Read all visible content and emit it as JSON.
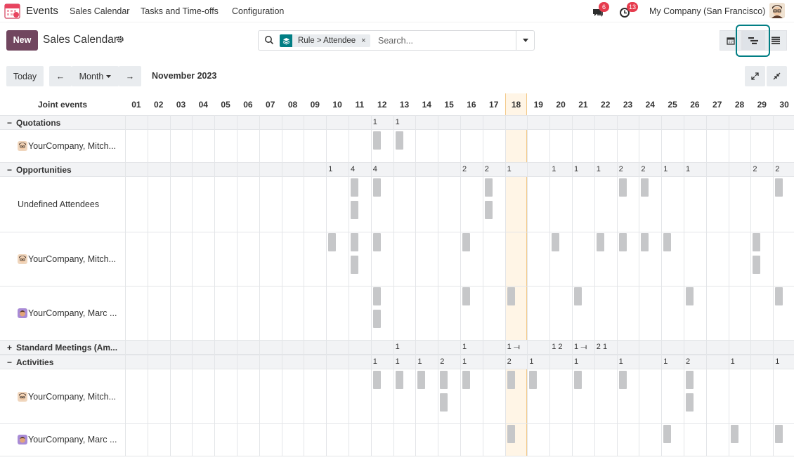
{
  "navbar": {
    "app_name": "Events",
    "menus": [
      "Sales Calendar",
      "Tasks and Time-offs",
      "Configuration"
    ],
    "messages_count": "6",
    "activities_count": "13",
    "company": "My Company (San Francisco)"
  },
  "control": {
    "new_label": "New",
    "title": "Sales Calendar",
    "facet_label": "Rule > Attendee",
    "facet_remove": "×",
    "search_placeholder": "Search..."
  },
  "toolbar": {
    "today_label": "Today",
    "prev_label": "←",
    "scale_label": "Month",
    "next_label": "→",
    "period": "November 2023"
  },
  "gantt": {
    "corner_label": "Joint events",
    "days": [
      "01",
      "02",
      "03",
      "04",
      "05",
      "06",
      "07",
      "08",
      "09",
      "10",
      "11",
      "12",
      "13",
      "14",
      "15",
      "16",
      "17",
      "18",
      "19",
      "20",
      "21",
      "22",
      "23",
      "24",
      "25",
      "26",
      "27",
      "28",
      "29",
      "30"
    ],
    "today_index": 17,
    "groups": [
      {
        "label": "Quotations",
        "toggle": "−",
        "counts": {
          "12": "1",
          "13": "1"
        },
        "rows": [
          {
            "label": "YourCompany, Mitch...",
            "avatar": "mitchell",
            "bars": [
              [
                12,
                1,
                0
              ],
              [
                13,
                1,
                0
              ]
            ]
          }
        ]
      },
      {
        "label": "Opportunities",
        "toggle": "−",
        "counts": {
          "10": "1",
          "11": "4",
          "12": "4",
          "16": "2",
          "17": "2",
          "18": "1",
          "20": "1",
          "21": "1",
          "22": "1",
          "23": "2",
          "24": "2",
          "25": "1",
          "26": "1",
          "29": "2",
          "30": "2"
        },
        "rows": [
          {
            "label": "Undefined Attendees",
            "avatar": "",
            "bars": [
              [
                11,
                1,
                0
              ],
              [
                11,
                1,
                1
              ],
              [
                12,
                1,
                0
              ],
              [
                17,
                1,
                0
              ],
              [
                17,
                1,
                1
              ],
              [
                23,
                1,
                0
              ],
              [
                24,
                1,
                0
              ],
              [
                30,
                1,
                0
              ]
            ]
          },
          {
            "label": "YourCompany, Mitch...",
            "avatar": "mitchell",
            "bars": [
              [
                10,
                1,
                0
              ],
              [
                11,
                1,
                0
              ],
              [
                11,
                1,
                1
              ],
              [
                12,
                1,
                0
              ],
              [
                16,
                1,
                0
              ],
              [
                20,
                1,
                0
              ],
              [
                22,
                1,
                0
              ],
              [
                23,
                1,
                0
              ],
              [
                24,
                1,
                0
              ],
              [
                25,
                1,
                0
              ],
              [
                29,
                1,
                0
              ],
              [
                29,
                1,
                1
              ]
            ]
          },
          {
            "label": "YourCompany, Marc ...",
            "avatar": "marc",
            "bars": [
              [
                12,
                1,
                0
              ],
              [
                12,
                1,
                1
              ],
              [
                16,
                1,
                0
              ],
              [
                18,
                1,
                0
              ],
              [
                21,
                1,
                0
              ],
              [
                26,
                1,
                0
              ],
              [
                30,
                1,
                0
              ]
            ]
          }
        ]
      },
      {
        "label": "Standard Meetings (Am...",
        "toggle": "+",
        "counts": {
          "13": "1",
          "16": "1",
          "18": "1 ⟞",
          "20": "1 2",
          "21": "1 ⟞",
          "22": "2 1"
        },
        "rows": []
      },
      {
        "label": "Activities",
        "toggle": "−",
        "counts": {
          "12": "1",
          "13": "1",
          "14": "1",
          "15": "2",
          "16": "1",
          "18": "2",
          "19": "1",
          "21": "1",
          "23": "1",
          "25": "1",
          "26": "2",
          "28": "1",
          "30": "1"
        },
        "rows": [
          {
            "label": "YourCompany, Mitch...",
            "avatar": "mitchell",
            "bars": [
              [
                12,
                1,
                0
              ],
              [
                13,
                1,
                0
              ],
              [
                14,
                1,
                0
              ],
              [
                15,
                1,
                0
              ],
              [
                15,
                1,
                1
              ],
              [
                16,
                1,
                0
              ],
              [
                18,
                1,
                0
              ],
              [
                19,
                1,
                0
              ],
              [
                21,
                1,
                0
              ],
              [
                23,
                1,
                0
              ],
              [
                26,
                1,
                0
              ],
              [
                26,
                1,
                1
              ]
            ]
          },
          {
            "label": "YourCompany, Marc ...",
            "avatar": "marc",
            "bars": [
              [
                18,
                1,
                0
              ],
              [
                25,
                1,
                0
              ],
              [
                28,
                1,
                0
              ],
              [
                30,
                1,
                0
              ]
            ]
          }
        ]
      }
    ]
  },
  "colors": {
    "primary": "#71465f",
    "accent": "#017e84",
    "bar": "#c6c7c9",
    "today_bg": "#fff5e6",
    "badge": "#e63c4e"
  }
}
